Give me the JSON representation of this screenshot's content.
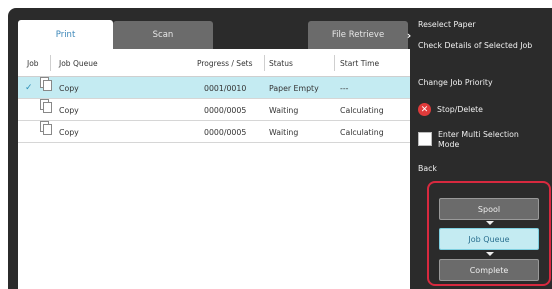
{
  "tabs": {
    "print": "Print",
    "scan": "Scan",
    "file_retrieve": "File Retrieve"
  },
  "table": {
    "headers": {
      "job": "Job",
      "job_queue": "Job Queue",
      "progress": "Progress / Sets",
      "status": "Status",
      "start_time": "Start Time"
    },
    "rows": [
      {
        "name": "Copy",
        "progress": "0001/0010",
        "status": "Paper Empty",
        "start_time": "---",
        "selected": true
      },
      {
        "name": "Copy",
        "progress": "0000/0005",
        "status": "Waiting",
        "start_time": "Calculating",
        "selected": false
      },
      {
        "name": "Copy",
        "progress": "0000/0005",
        "status": "Waiting",
        "start_time": "Calculating",
        "selected": false
      }
    ]
  },
  "menu": {
    "collapse_icon": "chevron-right",
    "reselect_paper": "Reselect Paper",
    "check_details": "Check Details of Selected Job",
    "change_priority": "Change Job Priority",
    "stop_delete": "Stop/Delete",
    "multi_selection": "Enter Multi Selection Mode",
    "back": "Back"
  },
  "mode": {
    "spool": "Spool",
    "job_queue": "Job Queue",
    "complete": "Complete",
    "selected": "Job Queue"
  },
  "colors": {
    "selection": "#c4ebf2",
    "highlight_border": "#d8293f",
    "stop_icon": "#e03b3b",
    "tab_active_text": "#3b86b8"
  }
}
